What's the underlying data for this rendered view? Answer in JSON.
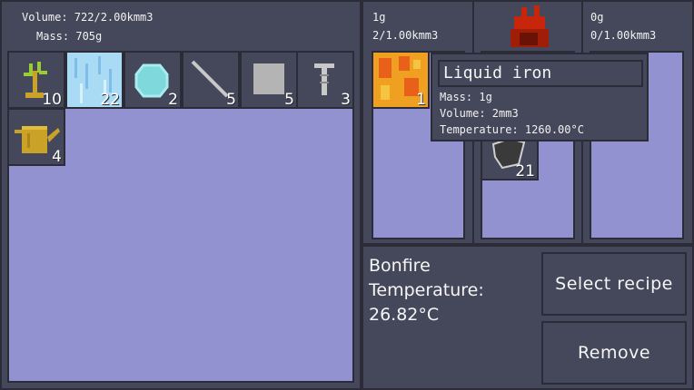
{
  "inventory": {
    "volume_text": "Volume: 722/2.00kmm3",
    "mass_text": "Mass: 705g",
    "items": [
      {
        "name": "sapling",
        "count": "10"
      },
      {
        "name": "ice",
        "count": "22"
      },
      {
        "name": "crystal",
        "count": "2"
      },
      {
        "name": "stick",
        "count": "5"
      },
      {
        "name": "stone-block",
        "count": "5"
      },
      {
        "name": "bolt",
        "count": "3"
      },
      {
        "name": "watering-can",
        "count": "4"
      }
    ]
  },
  "fire_slots": {
    "left": {
      "mass_text": "1g",
      "volume_text": "2/1.00kmm3",
      "item_count": "1"
    },
    "middle": {
      "item_count": "21"
    },
    "right": {
      "mass_text": "0g",
      "volume_text": "0/1.00kmm3"
    }
  },
  "tooltip": {
    "title": "Liquid iron",
    "mass": "Mass: 1g",
    "volume": "Volume: 2mm3",
    "temperature": "Temperature: 1260.00°C"
  },
  "station": {
    "name": "Bonfire",
    "temperature_label": "Temperature:",
    "temperature_value": "26.82°C"
  },
  "buttons": {
    "select_recipe": "Select recipe",
    "remove": "Remove"
  },
  "colors": {
    "panel": "#45475a",
    "slot_area": "#9392d0",
    "border": "#2b2c38",
    "fire": "#c8260a"
  }
}
